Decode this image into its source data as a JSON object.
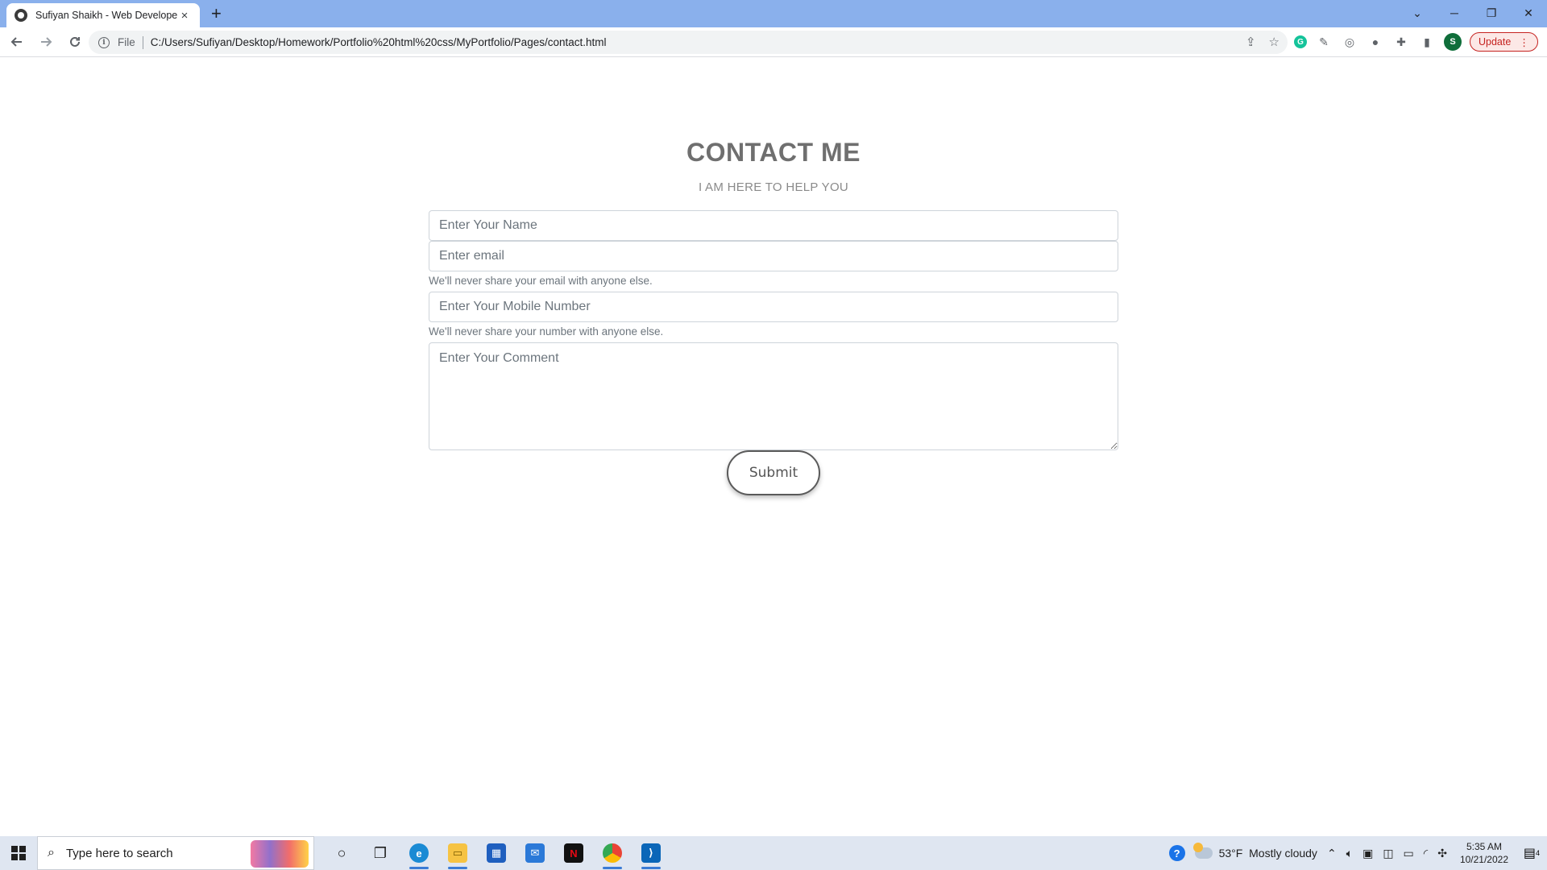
{
  "browser": {
    "tab_title": "Sufiyan Shaikh - Web Developer",
    "tab_close": "×",
    "new_tab": "+",
    "scheme": "File",
    "url": "C:/Users/Sufiyan/Desktop/Homework/Portfolio%20html%20css/MyPortfolio/Pages/contact.html",
    "profile_initial": "S",
    "update_label": "Update",
    "window_controls": {
      "search_tabs": "⌄",
      "minimize": "─",
      "restore": "❐",
      "close": "✕"
    }
  },
  "contact": {
    "title": "CONTACT ME",
    "subtitle": "I AM HERE TO HELP YOU",
    "name_placeholder": "Enter Your Name",
    "email_placeholder": "Enter email",
    "email_help": "We'll never share your email with anyone else.",
    "mobile_placeholder": "Enter Your Mobile Number",
    "mobile_help": "We'll never share your number with anyone else.",
    "comment_placeholder": "Enter Your Comment",
    "submit_label": "Submit"
  },
  "taskbar": {
    "search_placeholder": "Type here to search",
    "weather_temp": "53°F",
    "weather_desc": "Mostly cloudy",
    "time": "5:35 AM",
    "date": "10/21/2022",
    "notification_count": "4"
  },
  "colors": {
    "tabstrip": "#8ab0ec",
    "title_text": "#6f6f6f",
    "taskbar": "#dfe6f1",
    "update_accent": "#c5221f"
  }
}
